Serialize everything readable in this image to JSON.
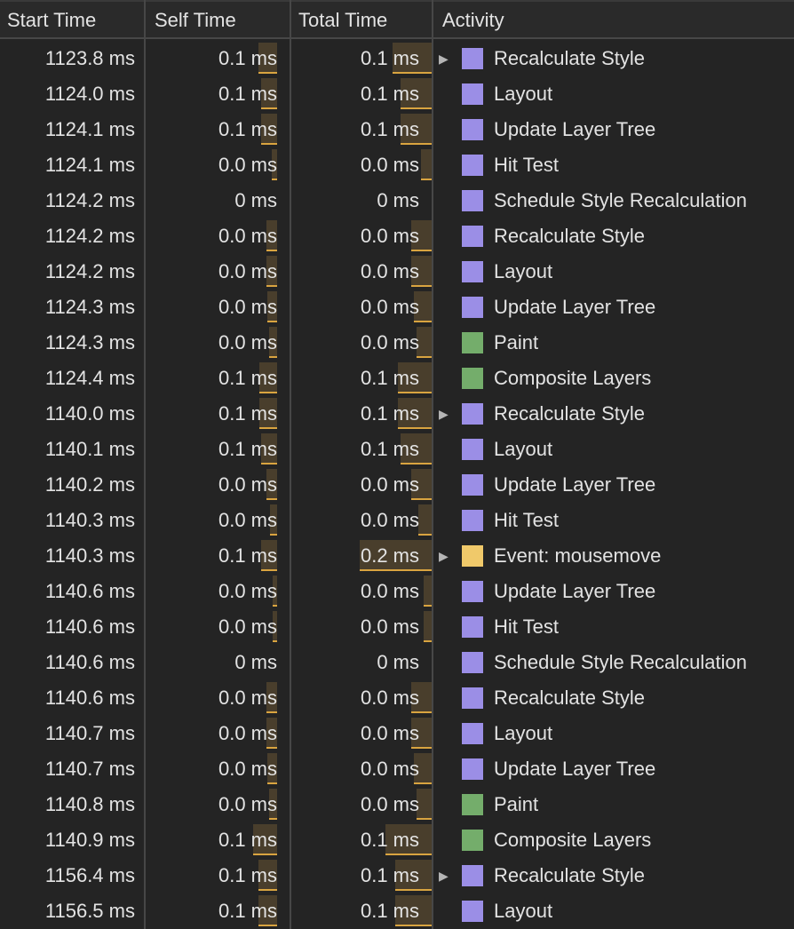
{
  "header": {
    "start_time": "Start Time",
    "self_time": "Self Time",
    "total_time": "Total Time",
    "activity": "Activity"
  },
  "colors": {
    "rendering": "#9b8ee6",
    "painting": "#74ad6b",
    "scripting": "#f0c96a",
    "bar_fill": "rgba(120,96,56,0.45)",
    "bar_accent": "#d9a440"
  },
  "rows": [
    {
      "start": "1123.8 ms",
      "self": "0.1 ms",
      "total": "0.1 ms",
      "activity": "Recalculate Style",
      "category": "rendering",
      "expandable": true,
      "self_bar": 0.14,
      "total_bar": 0.3
    },
    {
      "start": "1124.0 ms",
      "self": "0.1 ms",
      "total": "0.1 ms",
      "activity": "Layout",
      "category": "rendering",
      "expandable": false,
      "self_bar": 0.12,
      "total_bar": 0.24
    },
    {
      "start": "1124.1 ms",
      "self": "0.1 ms",
      "total": "0.1 ms",
      "activity": "Update Layer Tree",
      "category": "rendering",
      "expandable": false,
      "self_bar": 0.12,
      "total_bar": 0.24
    },
    {
      "start": "1124.1 ms",
      "self": "0.0 ms",
      "total": "0.0 ms",
      "activity": "Hit Test",
      "category": "rendering",
      "expandable": false,
      "self_bar": 0.04,
      "total_bar": 0.08
    },
    {
      "start": "1124.2 ms",
      "self": "0 ms",
      "total": "0 ms",
      "activity": "Schedule Style Recalculation",
      "category": "rendering",
      "expandable": false,
      "self_bar": 0,
      "total_bar": 0
    },
    {
      "start": "1124.2 ms",
      "self": "0.0 ms",
      "total": "0.0 ms",
      "activity": "Recalculate Style",
      "category": "rendering",
      "expandable": false,
      "self_bar": 0.08,
      "total_bar": 0.16
    },
    {
      "start": "1124.2 ms",
      "self": "0.0 ms",
      "total": "0.0 ms",
      "activity": "Layout",
      "category": "rendering",
      "expandable": false,
      "self_bar": 0.08,
      "total_bar": 0.16
    },
    {
      "start": "1124.3 ms",
      "self": "0.0 ms",
      "total": "0.0 ms",
      "activity": "Update Layer Tree",
      "category": "rendering",
      "expandable": false,
      "self_bar": 0.07,
      "total_bar": 0.14
    },
    {
      "start": "1124.3 ms",
      "self": "0.0 ms",
      "total": "0.0 ms",
      "activity": "Paint",
      "category": "painting",
      "expandable": false,
      "self_bar": 0.06,
      "total_bar": 0.12
    },
    {
      "start": "1124.4 ms",
      "self": "0.1 ms",
      "total": "0.1 ms",
      "activity": "Composite Layers",
      "category": "painting",
      "expandable": false,
      "self_bar": 0.13,
      "total_bar": 0.26
    },
    {
      "start": "1140.0 ms",
      "self": "0.1 ms",
      "total": "0.1 ms",
      "activity": "Recalculate Style",
      "category": "rendering",
      "expandable": true,
      "self_bar": 0.13,
      "total_bar": 0.26
    },
    {
      "start": "1140.1 ms",
      "self": "0.1 ms",
      "total": "0.1 ms",
      "activity": "Layout",
      "category": "rendering",
      "expandable": false,
      "self_bar": 0.12,
      "total_bar": 0.24
    },
    {
      "start": "1140.2 ms",
      "self": "0.0 ms",
      "total": "0.0 ms",
      "activity": "Update Layer Tree",
      "category": "rendering",
      "expandable": false,
      "self_bar": 0.08,
      "total_bar": 0.16
    },
    {
      "start": "1140.3 ms",
      "self": "0.0 ms",
      "total": "0.0 ms",
      "activity": "Hit Test",
      "category": "rendering",
      "expandable": false,
      "self_bar": 0.05,
      "total_bar": 0.1
    },
    {
      "start": "1140.3 ms",
      "self": "0.1 ms",
      "total": "0.2 ms",
      "activity": "Event: mousemove",
      "category": "scripting",
      "expandable": true,
      "self_bar": 0.12,
      "total_bar": 0.56
    },
    {
      "start": "1140.6 ms",
      "self": "0.0 ms",
      "total": "0.0 ms",
      "activity": "Update Layer Tree",
      "category": "rendering",
      "expandable": false,
      "self_bar": 0.03,
      "total_bar": 0.06
    },
    {
      "start": "1140.6 ms",
      "self": "0.0 ms",
      "total": "0.0 ms",
      "activity": "Hit Test",
      "category": "rendering",
      "expandable": false,
      "self_bar": 0.03,
      "total_bar": 0.06
    },
    {
      "start": "1140.6 ms",
      "self": "0 ms",
      "total": "0 ms",
      "activity": "Schedule Style Recalculation",
      "category": "rendering",
      "expandable": false,
      "self_bar": 0,
      "total_bar": 0
    },
    {
      "start": "1140.6 ms",
      "self": "0.0 ms",
      "total": "0.0 ms",
      "activity": "Recalculate Style",
      "category": "rendering",
      "expandable": false,
      "self_bar": 0.08,
      "total_bar": 0.16
    },
    {
      "start": "1140.7 ms",
      "self": "0.0 ms",
      "total": "0.0 ms",
      "activity": "Layout",
      "category": "rendering",
      "expandable": false,
      "self_bar": 0.08,
      "total_bar": 0.16
    },
    {
      "start": "1140.7 ms",
      "self": "0.0 ms",
      "total": "0.0 ms",
      "activity": "Update Layer Tree",
      "category": "rendering",
      "expandable": false,
      "self_bar": 0.07,
      "total_bar": 0.14
    },
    {
      "start": "1140.8 ms",
      "self": "0.0 ms",
      "total": "0.0 ms",
      "activity": "Paint",
      "category": "painting",
      "expandable": false,
      "self_bar": 0.06,
      "total_bar": 0.12
    },
    {
      "start": "1140.9 ms",
      "self": "0.1 ms",
      "total": "0.1 ms",
      "activity": "Composite Layers",
      "category": "painting",
      "expandable": false,
      "self_bar": 0.18,
      "total_bar": 0.36
    },
    {
      "start": "1156.4 ms",
      "self": "0.1 ms",
      "total": "0.1 ms",
      "activity": "Recalculate Style",
      "category": "rendering",
      "expandable": true,
      "self_bar": 0.14,
      "total_bar": 0.28
    },
    {
      "start": "1156.5 ms",
      "self": "0.1 ms",
      "total": "0.1 ms",
      "activity": "Layout",
      "category": "rendering",
      "expandable": false,
      "self_bar": 0.14,
      "total_bar": 0.28
    }
  ]
}
